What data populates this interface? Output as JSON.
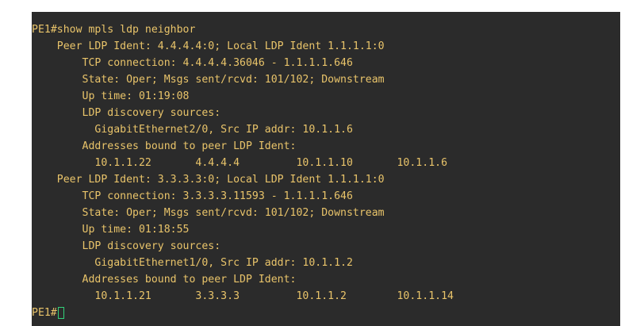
{
  "terminal": {
    "text_color": "#e9c46a",
    "background": "#2b2b2b",
    "cursor_color": "#33d17a",
    "lines": [
      "PE1#show mpls ldp neighbor",
      "    Peer LDP Ident: 4.4.4.4:0; Local LDP Ident 1.1.1.1:0",
      "        TCP connection: 4.4.4.4.36046 - 1.1.1.1.646",
      "        State: Oper; Msgs sent/rcvd: 101/102; Downstream",
      "        Up time: 01:19:08",
      "        LDP discovery sources:",
      "          GigabitEthernet2/0, Src IP addr: 10.1.1.6",
      "        Addresses bound to peer LDP Ident:",
      "          10.1.1.22       4.4.4.4         10.1.1.10       10.1.1.6",
      "    Peer LDP Ident: 3.3.3.3:0; Local LDP Ident 1.1.1.1:0",
      "        TCP connection: 3.3.3.3.11593 - 1.1.1.1.646",
      "        State: Oper; Msgs sent/rcvd: 101/102; Downstream",
      "        Up time: 01:18:55",
      "        LDP discovery sources:",
      "          GigabitEthernet1/0, Src IP addr: 10.1.1.2",
      "        Addresses bound to peer LDP Ident:",
      "          10.1.1.21       3.3.3.3         10.1.1.2        10.1.1.14"
    ],
    "prompt": "PE1#"
  }
}
